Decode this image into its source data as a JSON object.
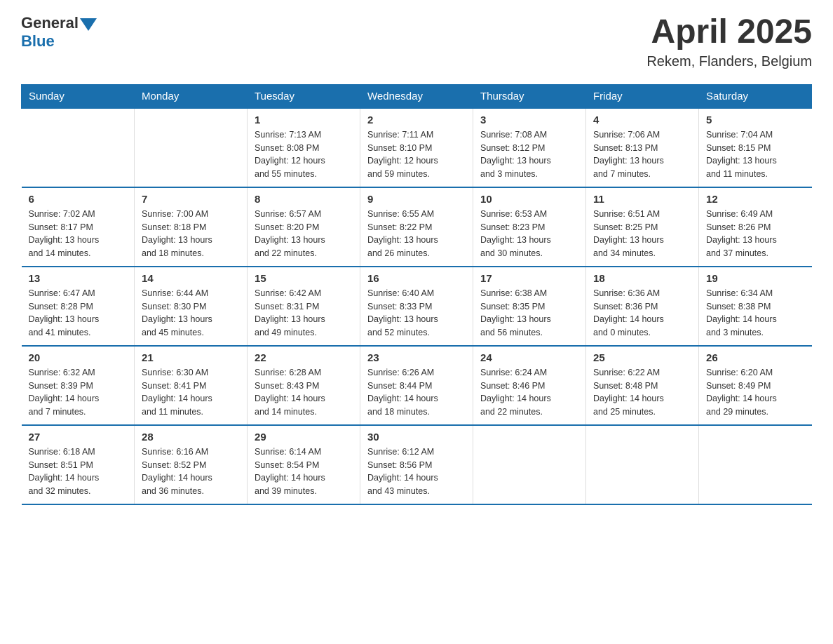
{
  "header": {
    "logo_general": "General",
    "logo_blue": "Blue",
    "month_year": "April 2025",
    "location": "Rekem, Flanders, Belgium"
  },
  "days_of_week": [
    "Sunday",
    "Monday",
    "Tuesday",
    "Wednesday",
    "Thursday",
    "Friday",
    "Saturday"
  ],
  "weeks": [
    [
      {
        "day": "",
        "info": ""
      },
      {
        "day": "",
        "info": ""
      },
      {
        "day": "1",
        "info": "Sunrise: 7:13 AM\nSunset: 8:08 PM\nDaylight: 12 hours\nand 55 minutes."
      },
      {
        "day": "2",
        "info": "Sunrise: 7:11 AM\nSunset: 8:10 PM\nDaylight: 12 hours\nand 59 minutes."
      },
      {
        "day": "3",
        "info": "Sunrise: 7:08 AM\nSunset: 8:12 PM\nDaylight: 13 hours\nand 3 minutes."
      },
      {
        "day": "4",
        "info": "Sunrise: 7:06 AM\nSunset: 8:13 PM\nDaylight: 13 hours\nand 7 minutes."
      },
      {
        "day": "5",
        "info": "Sunrise: 7:04 AM\nSunset: 8:15 PM\nDaylight: 13 hours\nand 11 minutes."
      }
    ],
    [
      {
        "day": "6",
        "info": "Sunrise: 7:02 AM\nSunset: 8:17 PM\nDaylight: 13 hours\nand 14 minutes."
      },
      {
        "day": "7",
        "info": "Sunrise: 7:00 AM\nSunset: 8:18 PM\nDaylight: 13 hours\nand 18 minutes."
      },
      {
        "day": "8",
        "info": "Sunrise: 6:57 AM\nSunset: 8:20 PM\nDaylight: 13 hours\nand 22 minutes."
      },
      {
        "day": "9",
        "info": "Sunrise: 6:55 AM\nSunset: 8:22 PM\nDaylight: 13 hours\nand 26 minutes."
      },
      {
        "day": "10",
        "info": "Sunrise: 6:53 AM\nSunset: 8:23 PM\nDaylight: 13 hours\nand 30 minutes."
      },
      {
        "day": "11",
        "info": "Sunrise: 6:51 AM\nSunset: 8:25 PM\nDaylight: 13 hours\nand 34 minutes."
      },
      {
        "day": "12",
        "info": "Sunrise: 6:49 AM\nSunset: 8:26 PM\nDaylight: 13 hours\nand 37 minutes."
      }
    ],
    [
      {
        "day": "13",
        "info": "Sunrise: 6:47 AM\nSunset: 8:28 PM\nDaylight: 13 hours\nand 41 minutes."
      },
      {
        "day": "14",
        "info": "Sunrise: 6:44 AM\nSunset: 8:30 PM\nDaylight: 13 hours\nand 45 minutes."
      },
      {
        "day": "15",
        "info": "Sunrise: 6:42 AM\nSunset: 8:31 PM\nDaylight: 13 hours\nand 49 minutes."
      },
      {
        "day": "16",
        "info": "Sunrise: 6:40 AM\nSunset: 8:33 PM\nDaylight: 13 hours\nand 52 minutes."
      },
      {
        "day": "17",
        "info": "Sunrise: 6:38 AM\nSunset: 8:35 PM\nDaylight: 13 hours\nand 56 minutes."
      },
      {
        "day": "18",
        "info": "Sunrise: 6:36 AM\nSunset: 8:36 PM\nDaylight: 14 hours\nand 0 minutes."
      },
      {
        "day": "19",
        "info": "Sunrise: 6:34 AM\nSunset: 8:38 PM\nDaylight: 14 hours\nand 3 minutes."
      }
    ],
    [
      {
        "day": "20",
        "info": "Sunrise: 6:32 AM\nSunset: 8:39 PM\nDaylight: 14 hours\nand 7 minutes."
      },
      {
        "day": "21",
        "info": "Sunrise: 6:30 AM\nSunset: 8:41 PM\nDaylight: 14 hours\nand 11 minutes."
      },
      {
        "day": "22",
        "info": "Sunrise: 6:28 AM\nSunset: 8:43 PM\nDaylight: 14 hours\nand 14 minutes."
      },
      {
        "day": "23",
        "info": "Sunrise: 6:26 AM\nSunset: 8:44 PM\nDaylight: 14 hours\nand 18 minutes."
      },
      {
        "day": "24",
        "info": "Sunrise: 6:24 AM\nSunset: 8:46 PM\nDaylight: 14 hours\nand 22 minutes."
      },
      {
        "day": "25",
        "info": "Sunrise: 6:22 AM\nSunset: 8:48 PM\nDaylight: 14 hours\nand 25 minutes."
      },
      {
        "day": "26",
        "info": "Sunrise: 6:20 AM\nSunset: 8:49 PM\nDaylight: 14 hours\nand 29 minutes."
      }
    ],
    [
      {
        "day": "27",
        "info": "Sunrise: 6:18 AM\nSunset: 8:51 PM\nDaylight: 14 hours\nand 32 minutes."
      },
      {
        "day": "28",
        "info": "Sunrise: 6:16 AM\nSunset: 8:52 PM\nDaylight: 14 hours\nand 36 minutes."
      },
      {
        "day": "29",
        "info": "Sunrise: 6:14 AM\nSunset: 8:54 PM\nDaylight: 14 hours\nand 39 minutes."
      },
      {
        "day": "30",
        "info": "Sunrise: 6:12 AM\nSunset: 8:56 PM\nDaylight: 14 hours\nand 43 minutes."
      },
      {
        "day": "",
        "info": ""
      },
      {
        "day": "",
        "info": ""
      },
      {
        "day": "",
        "info": ""
      }
    ]
  ]
}
